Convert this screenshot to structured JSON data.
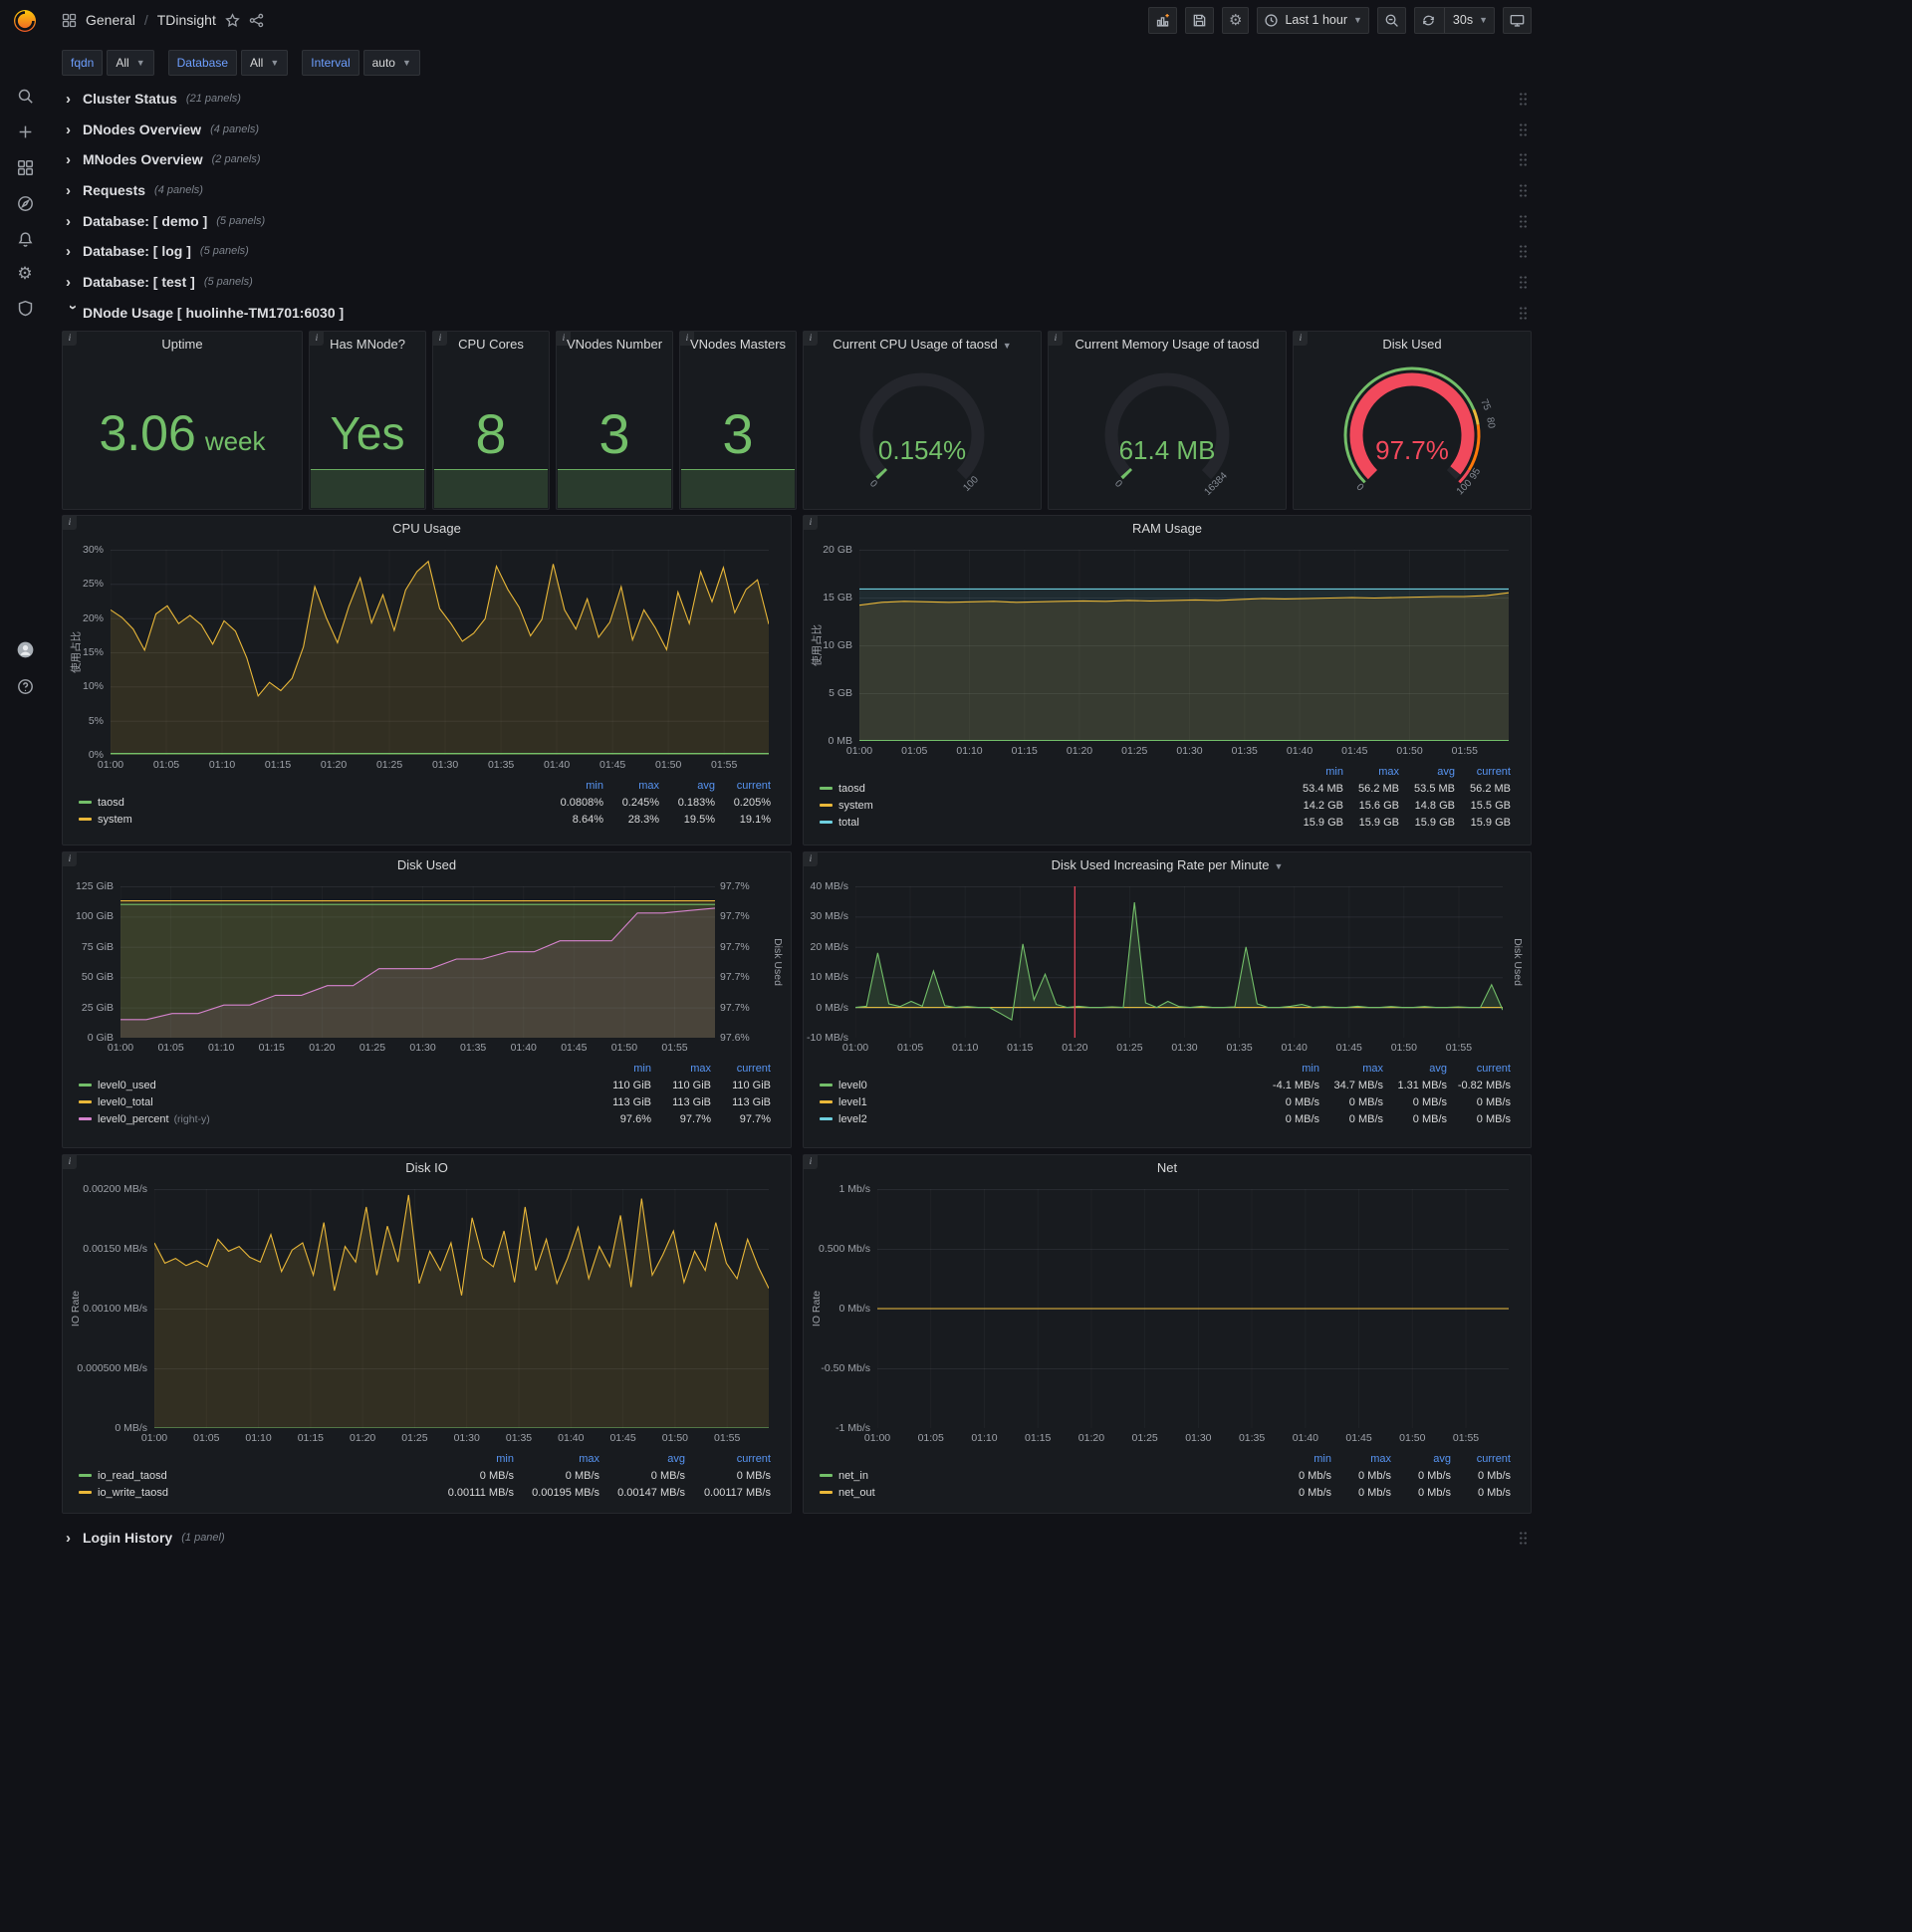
{
  "colors": {
    "green": "#73bf69",
    "yellow": "#eab839",
    "blue": "#6ed0e0",
    "pink": "#d683ce",
    "red": "#f2495c",
    "orange": "#ff780a",
    "legend_header": "#5794f2"
  },
  "navbar": {
    "folder": "General",
    "separator": "/",
    "dashboard": "TDinsight",
    "time_range": "Last 1 hour",
    "refresh": "30s"
  },
  "variables": [
    {
      "label": "fqdn",
      "value": "All"
    },
    {
      "label": "Database",
      "value": "All"
    },
    {
      "label": "Interval",
      "value": "auto"
    }
  ],
  "rows": [
    {
      "title": "Cluster Status",
      "count": "(21 panels)"
    },
    {
      "title": "DNodes Overview",
      "count": "(4 panels)"
    },
    {
      "title": "MNodes Overview",
      "count": "(2 panels)"
    },
    {
      "title": "Requests",
      "count": "(4 panels)"
    },
    {
      "title": "Database: [ demo ]",
      "count": "(5 panels)"
    },
    {
      "title": "Database: [ log ]",
      "count": "(5 panels)"
    },
    {
      "title": "Database: [ test ]",
      "count": "(5 panels)"
    }
  ],
  "expanded_row": {
    "title": "DNode Usage [ huolinhe-TM1701:6030 ]"
  },
  "login_row": {
    "title": "Login History",
    "count": "(1 panel)"
  },
  "stats": [
    {
      "title": "Uptime",
      "value": "3.06",
      "unit": "week"
    },
    {
      "title": "Has MNode?",
      "value": "Yes"
    },
    {
      "title": "CPU Cores",
      "value": "8"
    },
    {
      "title": "VNodes Number",
      "value": "3"
    },
    {
      "title": "VNodes Masters",
      "value": "3"
    }
  ],
  "gauges": [
    {
      "title": "Current CPU Usage of taosd",
      "value": "0.154%",
      "fraction": 0.00154,
      "value_color": "green",
      "labels": [
        {
          "text": "0",
          "frac": 0
        },
        {
          "text": "100",
          "frac": 1
        }
      ]
    },
    {
      "title": "Current Memory Usage of taosd",
      "value": "61.4 MB",
      "fraction": 0.00375,
      "value_color": "green",
      "labels": [
        {
          "text": "0",
          "frac": 0
        },
        {
          "text": "16384",
          "frac": 1
        }
      ]
    },
    {
      "title": "Disk Used",
      "value": "97.7%",
      "fraction": 0.977,
      "value_color": "red",
      "labels": [
        {
          "text": "0",
          "frac": 0
        },
        {
          "text": "75",
          "frac": 0.75
        },
        {
          "text": "80",
          "frac": 0.8
        },
        {
          "text": "95",
          "frac": 0.95
        },
        {
          "text": "100",
          "frac": 1
        }
      ],
      "ring": [
        {
          "to": 0.75,
          "color": "green"
        },
        {
          "to": 0.8,
          "color": "yellow"
        },
        {
          "to": 0.95,
          "color": "orange"
        },
        {
          "to": 1,
          "color": "red"
        }
      ]
    }
  ],
  "chart_data": [
    {
      "id": "cpu_usage",
      "type": "line",
      "title": "CPU Usage",
      "ylabel": "使用占比",
      "ymin": 0,
      "ymax": 30,
      "yticks": [
        {
          "v": 30,
          "label": "30%"
        },
        {
          "v": 25,
          "label": "25%"
        },
        {
          "v": 20,
          "label": "20%"
        },
        {
          "v": 15,
          "label": "15%"
        },
        {
          "v": 10,
          "label": "10%"
        },
        {
          "v": 5,
          "label": "5%"
        },
        {
          "v": 0,
          "label": "0%"
        }
      ],
      "xticks": [
        "01:00",
        "01:05",
        "01:10",
        "01:15",
        "01:20",
        "01:25",
        "01:30",
        "01:35",
        "01:40",
        "01:45",
        "01:50",
        "01:55"
      ],
      "x_total_minutes": 59,
      "series": [
        {
          "name": "system",
          "color": "yellow",
          "fill": 0.13,
          "values": [
            21.2,
            20.1,
            18.4,
            15.3,
            20.6,
            21.8,
            19.2,
            20.4,
            19.0,
            16.2,
            19.6,
            18.1,
            14.2,
            8.6,
            10.6,
            9.4,
            11.2,
            15.8,
            24.6,
            20.1,
            16.4,
            21.7,
            25.9,
            19.3,
            23.4,
            18.2,
            24.1,
            26.8,
            28.3,
            21.4,
            19.2,
            16.6,
            17.8,
            19.9,
            27.6,
            24.2,
            21.6,
            17.4,
            19.8,
            27.9,
            21.2,
            18.4,
            22.8,
            17.2,
            19.4,
            24.6,
            16.8,
            21.2,
            18.6,
            15.4,
            23.8,
            19.2,
            26.8,
            22.4,
            27.4,
            20.8,
            24.2,
            25.6,
            19.1
          ]
        },
        {
          "name": "taosd",
          "color": "green",
          "fill": 0.3,
          "values": [
            0.2,
            0.2
          ]
        }
      ],
      "legend": {
        "cols": [
          "min",
          "max",
          "avg",
          "current"
        ],
        "rows": [
          {
            "name": "taosd",
            "color": "green",
            "values": [
              "0.0808%",
              "0.245%",
              "0.183%",
              "0.205%"
            ]
          },
          {
            "name": "system",
            "color": "yellow",
            "values": [
              "8.64%",
              "28.3%",
              "19.5%",
              "19.1%"
            ]
          }
        ]
      }
    },
    {
      "id": "ram_usage",
      "type": "line",
      "title": "RAM Usage",
      "ylabel": "使用占比",
      "ymin": 0,
      "ymax": 20,
      "yticks": [
        {
          "v": 20,
          "label": "20 GB"
        },
        {
          "v": 15,
          "label": "15 GB"
        },
        {
          "v": 10,
          "label": "10 GB"
        },
        {
          "v": 5,
          "label": "5 GB"
        },
        {
          "v": 0,
          "label": "0 MB"
        }
      ],
      "xticks": [
        "01:00",
        "01:05",
        "01:10",
        "01:15",
        "01:20",
        "01:25",
        "01:30",
        "01:35",
        "01:40",
        "01:45",
        "01:50",
        "01:55"
      ],
      "x_total_minutes": 59,
      "series": [
        {
          "name": "total",
          "color": "blue",
          "fill": 0.09,
          "values": [
            15.9,
            15.9
          ]
        },
        {
          "name": "system",
          "color": "yellow",
          "fill": 0.12,
          "values": [
            14.2,
            14.5,
            14.6,
            14.55,
            14.5,
            14.55,
            14.6,
            14.5,
            14.55,
            14.6,
            14.65,
            14.6,
            14.7,
            14.65,
            14.7,
            14.75,
            14.7,
            14.8,
            14.9,
            14.85,
            14.9,
            14.95,
            15.0,
            14.95,
            15.0,
            15.05,
            15.1,
            15.1,
            15.2,
            15.5
          ]
        },
        {
          "name": "taosd",
          "color": "green",
          "fill": 0.3,
          "values": [
            0.055,
            0.055
          ]
        }
      ],
      "legend": {
        "cols": [
          "min",
          "max",
          "avg",
          "current"
        ],
        "rows": [
          {
            "name": "taosd",
            "color": "green",
            "values": [
              "53.4 MB",
              "56.2 MB",
              "53.5 MB",
              "56.2 MB"
            ]
          },
          {
            "name": "system",
            "color": "yellow",
            "values": [
              "14.2 GB",
              "15.6 GB",
              "14.8 GB",
              "15.5 GB"
            ]
          },
          {
            "name": "total",
            "color": "blue",
            "values": [
              "15.9 GB",
              "15.9 GB",
              "15.9 GB",
              "15.9 GB"
            ]
          }
        ]
      }
    },
    {
      "id": "disk_used",
      "type": "line",
      "title": "Disk Used",
      "y2label": "Disk Used",
      "ymin": 0,
      "ymax": 125,
      "y2min": 97.595,
      "y2max": 97.72,
      "yticks": [
        {
          "v": 125,
          "label": "125 GiB"
        },
        {
          "v": 100,
          "label": "100 GiB"
        },
        {
          "v": 75,
          "label": "75 GiB"
        },
        {
          "v": 50,
          "label": "50 GiB"
        },
        {
          "v": 25,
          "label": "25 GiB"
        },
        {
          "v": 0,
          "label": "0 GiB"
        }
      ],
      "y2ticks": [
        "97.7%",
        "97.7%",
        "97.7%",
        "97.7%",
        "97.7%",
        "97.6%"
      ],
      "xticks": [
        "01:00",
        "01:05",
        "01:10",
        "01:15",
        "01:20",
        "01:25",
        "01:30",
        "01:35",
        "01:40",
        "01:45",
        "01:50",
        "01:55"
      ],
      "x_total_minutes": 59,
      "series": [
        {
          "name": "level0_total",
          "color": "yellow",
          "fill": 0.12,
          "values": [
            113,
            113
          ]
        },
        {
          "name": "level0_used",
          "color": "green",
          "fill": 0.12,
          "values": [
            110,
            110
          ]
        },
        {
          "name": "level0_percent",
          "color": "pink",
          "fill": 0.1,
          "axis": "right",
          "values": [
            97.61,
            97.61,
            97.615,
            97.615,
            97.622,
            97.622,
            97.63,
            97.63,
            97.638,
            97.638,
            97.652,
            97.652,
            97.652,
            97.66,
            97.66,
            97.666,
            97.666,
            97.675,
            97.675,
            97.675,
            97.698,
            97.698,
            97.7,
            97.702
          ]
        }
      ],
      "legend": {
        "cols": [
          "min",
          "max",
          "current"
        ],
        "rows": [
          {
            "name": "level0_used",
            "color": "green",
            "values": [
              "110 GiB",
              "110 GiB",
              "110 GiB"
            ]
          },
          {
            "name": "level0_total",
            "color": "yellow",
            "values": [
              "113 GiB",
              "113 GiB",
              "113 GiB"
            ]
          },
          {
            "name": "level0_percent",
            "suffix": "(right-y)",
            "color": "pink",
            "values": [
              "97.6%",
              "97.7%",
              "97.7%"
            ]
          }
        ]
      }
    },
    {
      "id": "disk_rate",
      "type": "line",
      "title": "Disk Used Increasing Rate per Minute",
      "y2label": "Disk Used",
      "ymin": -10,
      "ymax": 40,
      "annotation_min": 20,
      "yticks": [
        {
          "v": 40,
          "label": "40 MB/s"
        },
        {
          "v": 30,
          "label": "30 MB/s"
        },
        {
          "v": 20,
          "label": "20 MB/s"
        },
        {
          "v": 10,
          "label": "10 MB/s"
        },
        {
          "v": 0,
          "label": "0 MB/s"
        },
        {
          "v": -10,
          "label": "-10 MB/s"
        }
      ],
      "xticks": [
        "01:00",
        "01:05",
        "01:10",
        "01:15",
        "01:20",
        "01:25",
        "01:30",
        "01:35",
        "01:40",
        "01:45",
        "01:50",
        "01:55"
      ],
      "x_total_minutes": 59,
      "series": [
        {
          "name": "level2",
          "color": "blue",
          "fill": 0,
          "values": [
            0,
            0
          ]
        },
        {
          "name": "level1",
          "color": "yellow",
          "fill": 0,
          "values": [
            0,
            0
          ]
        },
        {
          "name": "level0",
          "color": "green",
          "fill": 0.18,
          "fill_base": 0,
          "values": [
            0,
            0.4,
            18,
            1.2,
            0.3,
            2,
            0.4,
            12,
            0.6,
            0,
            0.3,
            0,
            0,
            -2,
            -4.1,
            21,
            2.5,
            11,
            1,
            0,
            0.4,
            0,
            0,
            0.2,
            0,
            34.7,
            1.5,
            0,
            2,
            0.3,
            0,
            0.4,
            0,
            0,
            0.2,
            20,
            1.2,
            0,
            0,
            0.4,
            1,
            0,
            0.3,
            0,
            0,
            0.4,
            0,
            0,
            0.3,
            0,
            0,
            0.3,
            0,
            0,
            0.2,
            0,
            0,
            7.5,
            -0.82
          ]
        }
      ],
      "legend": {
        "cols": [
          "min",
          "max",
          "avg",
          "current"
        ],
        "rows": [
          {
            "name": "level0",
            "color": "green",
            "values": [
              "-4.1 MB/s",
              "34.7 MB/s",
              "1.31 MB/s",
              "-0.82 MB/s"
            ]
          },
          {
            "name": "level1",
            "color": "yellow",
            "values": [
              "0 MB/s",
              "0 MB/s",
              "0 MB/s",
              "0 MB/s"
            ]
          },
          {
            "name": "level2",
            "color": "blue",
            "values": [
              "0 MB/s",
              "0 MB/s",
              "0 MB/s",
              "0 MB/s"
            ]
          }
        ]
      }
    },
    {
      "id": "disk_io",
      "type": "line",
      "title": "Disk IO",
      "ylabel": "IO Rate",
      "ymin": 0,
      "ymax": 0.002,
      "yticks": [
        {
          "v": 0.002,
          "label": "0.00200 MB/s"
        },
        {
          "v": 0.0015,
          "label": "0.00150 MB/s"
        },
        {
          "v": 0.001,
          "label": "0.00100 MB/s"
        },
        {
          "v": 0.0005,
          "label": "0.000500 MB/s"
        },
        {
          "v": 0,
          "label": "0 MB/s"
        }
      ],
      "xticks": [
        "01:00",
        "01:05",
        "01:10",
        "01:15",
        "01:20",
        "01:25",
        "01:30",
        "01:35",
        "01:40",
        "01:45",
        "01:50",
        "01:55"
      ],
      "x_total_minutes": 59,
      "series": [
        {
          "name": "io_write_taosd",
          "color": "yellow",
          "fill": 0.13,
          "values": [
            0.00155,
            0.00138,
            0.00142,
            0.00136,
            0.0014,
            0.00135,
            0.00158,
            0.00148,
            0.00152,
            0.00143,
            0.00139,
            0.00162,
            0.00131,
            0.00149,
            0.00155,
            0.00128,
            0.00172,
            0.00115,
            0.00152,
            0.00139,
            0.00185,
            0.00128,
            0.00169,
            0.00139,
            0.00195,
            0.00121,
            0.00148,
            0.00132,
            0.00155,
            0.00111,
            0.00176,
            0.00142,
            0.00135,
            0.00165,
            0.00122,
            0.00185,
            0.00132,
            0.00158,
            0.00121,
            0.00142,
            0.00168,
            0.00125,
            0.00152,
            0.00135,
            0.00178,
            0.00118,
            0.00192,
            0.00128,
            0.00145,
            0.00165,
            0.00122,
            0.00148,
            0.00132,
            0.00172,
            0.00138,
            0.00125,
            0.00158,
            0.00135,
            0.00117
          ]
        },
        {
          "name": "io_read_taosd",
          "color": "green",
          "fill": 0.2,
          "values": [
            0,
            0
          ]
        }
      ],
      "legend": {
        "cols": [
          "min",
          "max",
          "avg",
          "current"
        ],
        "rows": [
          {
            "name": "io_read_taosd",
            "color": "green",
            "values": [
              "0 MB/s",
              "0 MB/s",
              "0 MB/s",
              "0 MB/s"
            ]
          },
          {
            "name": "io_write_taosd",
            "color": "yellow",
            "values": [
              "0.00111 MB/s",
              "0.00195 MB/s",
              "0.00147 MB/s",
              "0.00117 MB/s"
            ]
          }
        ]
      }
    },
    {
      "id": "net",
      "type": "line",
      "title": "Net",
      "ylabel": "IO Rate",
      "ymin": -1,
      "ymax": 1,
      "yticks": [
        {
          "v": 1,
          "label": "1 Mb/s"
        },
        {
          "v": 0.5,
          "label": "0.500 Mb/s"
        },
        {
          "v": 0,
          "label": "0 Mb/s"
        },
        {
          "v": -0.5,
          "label": "-0.50 Mb/s"
        },
        {
          "v": -1,
          "label": "-1 Mb/s"
        }
      ],
      "xticks": [
        "01:00",
        "01:05",
        "01:10",
        "01:15",
        "01:20",
        "01:25",
        "01:30",
        "01:35",
        "01:40",
        "01:45",
        "01:50",
        "01:55"
      ],
      "x_total_minutes": 59,
      "series": [
        {
          "name": "net_in",
          "color": "green",
          "fill": 0,
          "values": [
            0,
            0
          ]
        },
        {
          "name": "net_out",
          "color": "yellow",
          "fill": 0,
          "values": [
            0,
            0
          ]
        }
      ],
      "legend": {
        "cols": [
          "min",
          "max",
          "avg",
          "current"
        ],
        "rows": [
          {
            "name": "net_in",
            "color": "green",
            "values": [
              "0 Mb/s",
              "0 Mb/s",
              "0 Mb/s",
              "0 Mb/s"
            ]
          },
          {
            "name": "net_out",
            "color": "yellow",
            "values": [
              "0 Mb/s",
              "0 Mb/s",
              "0 Mb/s",
              "0 Mb/s"
            ]
          }
        ]
      }
    }
  ]
}
